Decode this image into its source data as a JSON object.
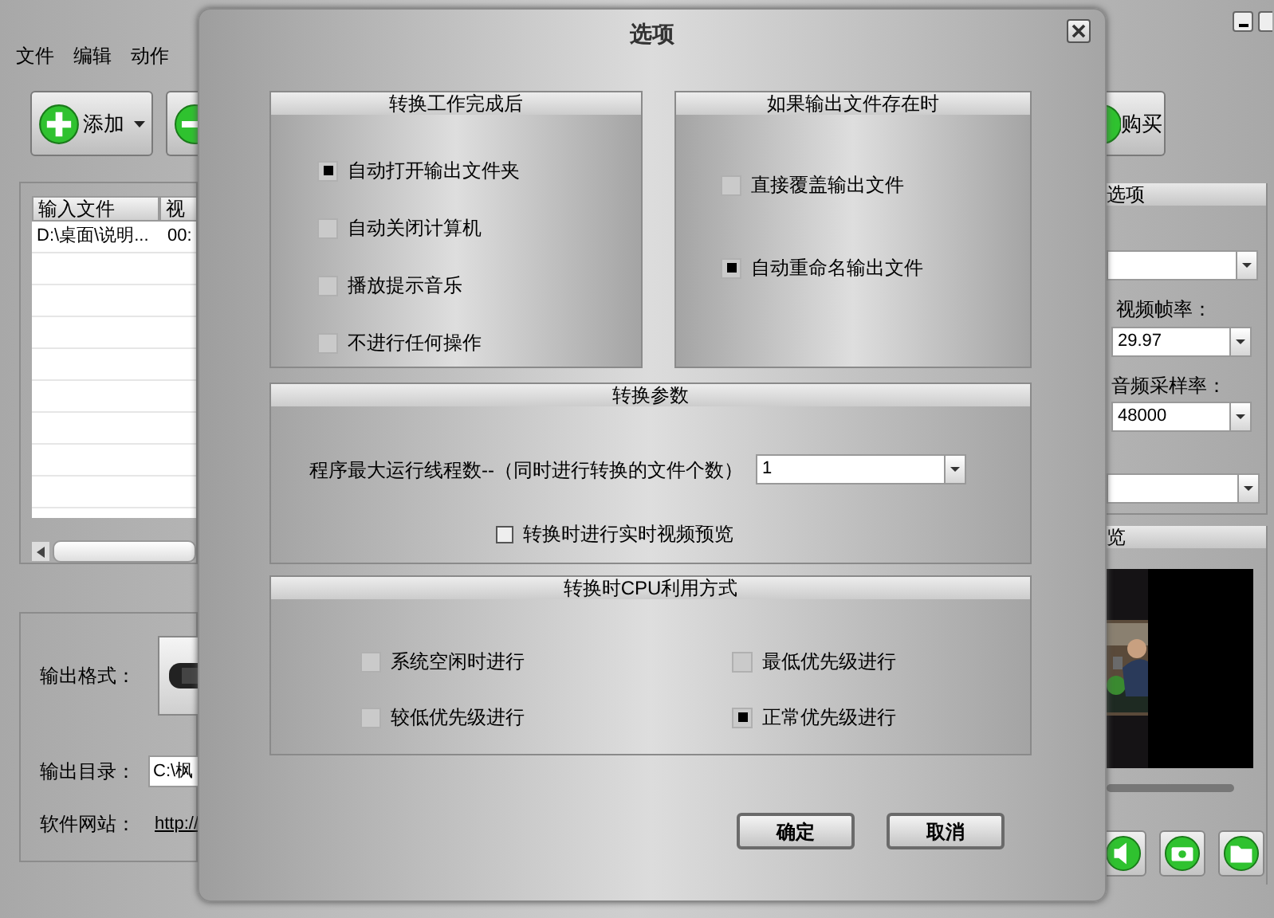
{
  "main_window": {
    "menu": [
      "文件",
      "编辑",
      "动作"
    ],
    "toolbar": [
      {
        "label": "添加",
        "kind": "add"
      },
      {
        "label": "购买",
        "kind": "buy"
      }
    ],
    "file_table": {
      "columns": [
        "输入文件",
        "视"
      ],
      "rows": [
        [
          "D:\\桌面\\说明...",
          "00:"
        ]
      ]
    },
    "output": {
      "format_label": "输出格式：",
      "dir_label": "输出目录：",
      "dir_value": "C:\\枫",
      "site_label": "软件网站：",
      "site_link": "http://"
    },
    "settings_panel": {
      "header": "选项",
      "frame_rate_label": "视频帧率：",
      "frame_rate": "29.97",
      "sample_rate_label": "音频采样率：",
      "sample_rate": "48000",
      "preview_header": "览"
    }
  },
  "dialog": {
    "title": "选项",
    "groups": [
      {
        "title": "转换工作完成后",
        "options": [
          {
            "label": "自动打开输出文件夹",
            "selected": true
          },
          {
            "label": "自动关闭计算机",
            "selected": false
          },
          {
            "label": "播放提示音乐",
            "selected": false
          },
          {
            "label": "不进行任何操作",
            "selected": false
          }
        ]
      },
      {
        "title": "如果输出文件存在时",
        "options": [
          {
            "label": "直接覆盖输出文件",
            "selected": false
          },
          {
            "label": "自动重命名输出文件",
            "selected": true
          }
        ]
      }
    ],
    "params": {
      "title": "转换参数",
      "thread_label": "程序最大运行线程数--（同时进行转换的文件个数）",
      "thread_value": "1",
      "preview_option": {
        "label": "转换时进行实时视频预览",
        "checked": false
      }
    },
    "cpu": {
      "title": "转换时CPU利用方式",
      "options": [
        {
          "label": "系统空闲时进行",
          "selected": false
        },
        {
          "label": "最低优先级进行",
          "selected": false
        },
        {
          "label": "较低优先级进行",
          "selected": false
        },
        {
          "label": "正常优先级进行",
          "selected": true
        }
      ]
    },
    "buttons": [
      "确定",
      "取消"
    ]
  }
}
